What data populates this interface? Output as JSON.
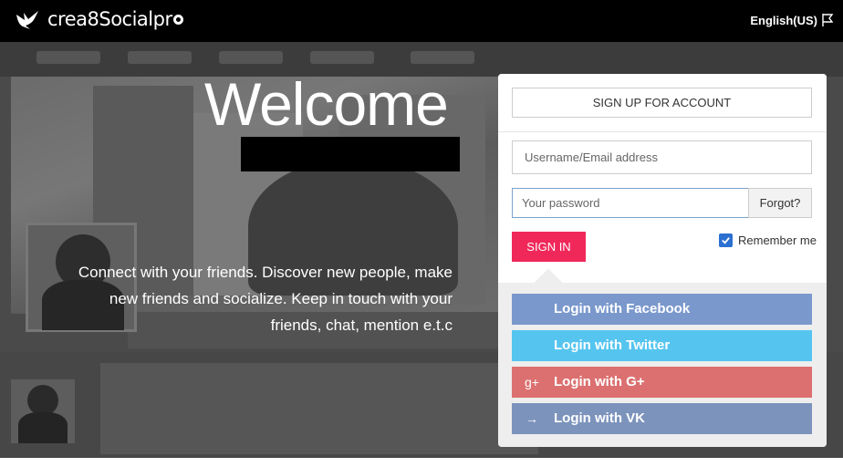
{
  "header": {
    "logo_text": "crea8Socialpr",
    "language": "English(US)"
  },
  "hero": {
    "title": "Welcome",
    "tagline_line1": "Connect with your friends. Discover new people, make",
    "tagline_line2": "new friends and socialize. Keep in touch with your",
    "tagline_line3": "friends, chat, mention e.t.c"
  },
  "login": {
    "signup_label": "SIGN UP FOR ACCOUNT",
    "username_placeholder": "Username/Email address",
    "password_placeholder": "Your password",
    "forgot_label": "Forgot?",
    "signin_label": "SIGN IN",
    "remember_label": "Remember me",
    "remember_checked": true
  },
  "social": {
    "facebook": "Login with Facebook",
    "twitter": "Login with Twitter",
    "google": "Login with G+",
    "google_icon": "g+",
    "vk": "Login with VK",
    "vk_icon": "→"
  },
  "colors": {
    "signin": "#f0285a",
    "facebook": "#7a98cc",
    "twitter": "#55c5f0",
    "google": "#dc7070",
    "vk": "#7c93bc"
  }
}
